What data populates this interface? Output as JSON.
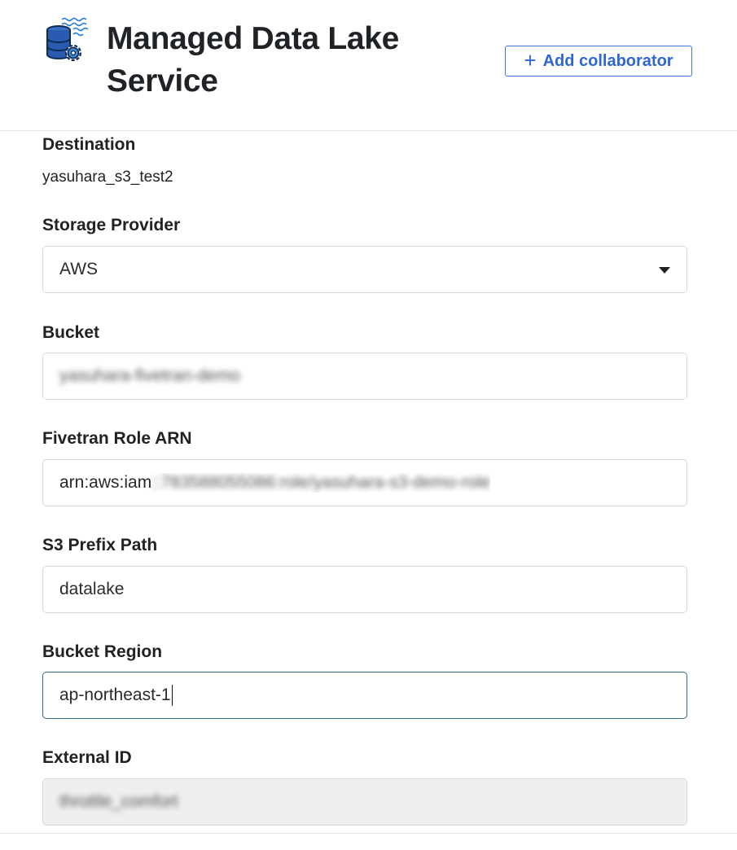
{
  "header": {
    "title": "Managed Data Lake Service",
    "add_collaborator_label": "Add collaborator",
    "logo_icon": "data-lake-service-icon",
    "accent_color": "#2f66d0"
  },
  "form": {
    "destination": {
      "label": "Destination",
      "value": "yasuhara_s3_test2"
    },
    "storage_provider": {
      "label": "Storage Provider",
      "value": "AWS"
    },
    "bucket": {
      "label": "Bucket",
      "value": "yasuhara-fivetran-demo",
      "redacted": true
    },
    "role_arn": {
      "label": "Fivetran Role ARN",
      "value_prefix": "arn:aws:iam",
      "value_redacted": "::783588055086:role/yasuhara-s3-demo-role"
    },
    "s3_prefix_path": {
      "label": "S3 Prefix Path",
      "value": "datalake"
    },
    "bucket_region": {
      "label": "Bucket Region",
      "value": "ap-northeast-1",
      "focused": true
    },
    "external_id": {
      "label": "External ID",
      "value": "throttle_comfort",
      "redacted": true,
      "readonly": true
    }
  }
}
